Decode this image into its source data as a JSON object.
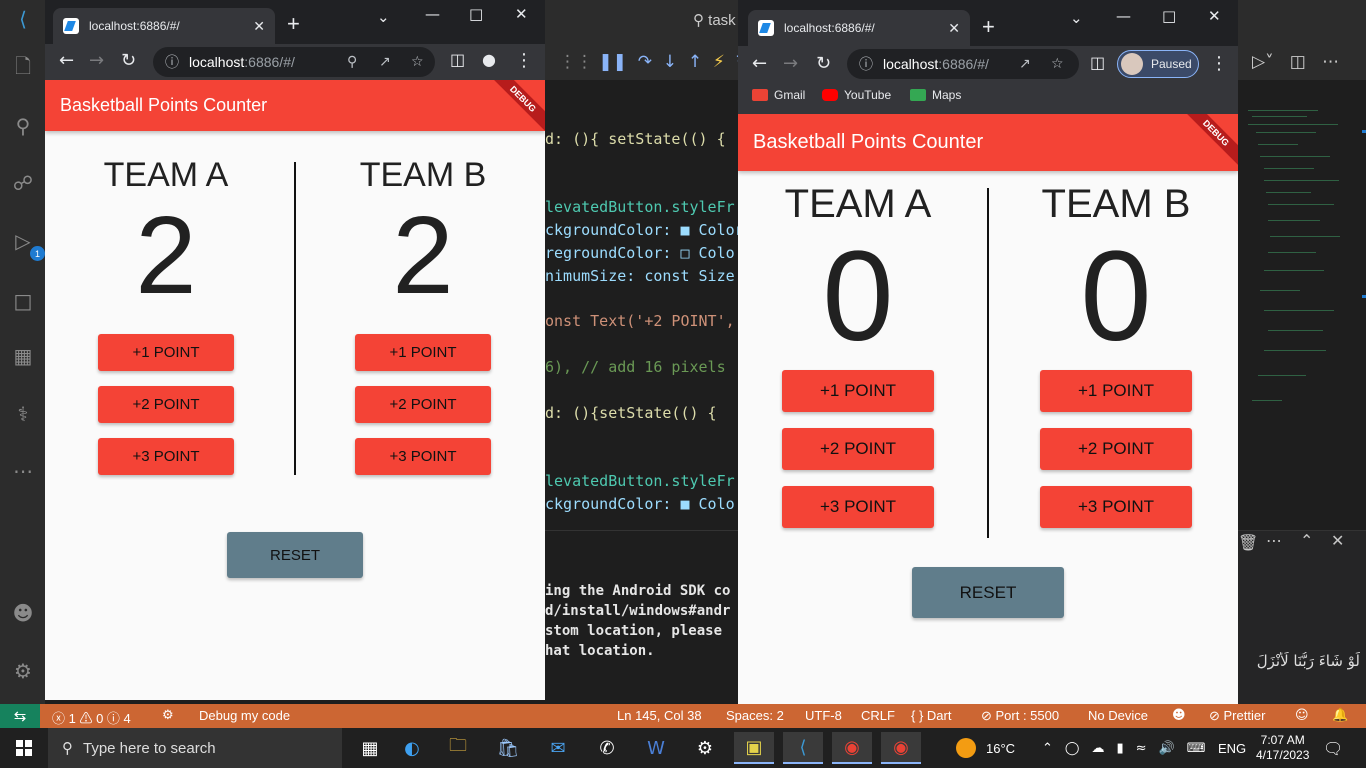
{
  "vscode": {
    "activity_badge": "1",
    "code_lines": [
      {
        "text": "d: (){ setState(() {",
        "cls": "fn"
      },
      {
        "text": "levatedButton.styleFr",
        "cls": "type"
      },
      {
        "text": "ckgroundColor: ■ Color",
        "cls": "prop"
      },
      {
        "text": "regroundColor: □ Colo",
        "cls": "prop"
      },
      {
        "text": "nimumSize: const Size",
        "cls": "prop"
      },
      {
        "text": "onst Text('+2 POINT',",
        "cls": "str"
      },
      {
        "text": "6), // add 16 pixels",
        "cls": "cmt"
      },
      {
        "text": "d: (){setState(() {",
        "cls": "fn"
      },
      {
        "text": "levatedButton.styleFr",
        "cls": "type"
      },
      {
        "text": "ckgroundColor: ■ Colo",
        "cls": "prop"
      }
    ],
    "terminal_lines": [
      "ing the Android SDK co",
      "d/install/windows#andr",
      "stom location, please",
      "hat location."
    ],
    "topbar_search": "task",
    "right_panel_text": "لَوْ شَاءَ رَبُّنَا لَأَنْزَلَ",
    "statusbar": {
      "problems": "ⓧ 1 ⚠ 0 ⓘ 4",
      "debug": "Debug my code",
      "position": "Ln 145, Col 38",
      "spaces": "Spaces: 2",
      "encoding": "UTF-8",
      "eol": "CRLF",
      "language": "{ } Dart",
      "port": "⊘ Port : 5500",
      "device": "No Device",
      "prettier": "⊘ Prettier"
    }
  },
  "taskbar": {
    "search_placeholder": "Type here to search",
    "weather": "16°C",
    "language": "ENG",
    "time": "7:07 AM",
    "date": "4/17/2023"
  },
  "browser_left": {
    "tab_title": "localhost:6886/#/",
    "url_host": "localhost",
    "url_path": ":6886/#/"
  },
  "browser_right": {
    "tab_title": "localhost:6886/#/",
    "url_host": "localhost",
    "url_path": ":6886/#/",
    "profile_label": "Paused",
    "bookmarks": [
      "Gmail",
      "YouTube",
      "Maps"
    ]
  },
  "app_left": {
    "title": "Basketball Points Counter",
    "debug": "DEBUG",
    "team_a": {
      "name": "TEAM A",
      "score": "2"
    },
    "team_b": {
      "name": "TEAM B",
      "score": "2"
    },
    "buttons": [
      "+1 POINT",
      "+2 POINT",
      "+3 POINT"
    ],
    "reset": "RESET"
  },
  "app_right": {
    "title": "Basketball Points Counter",
    "debug": "DEBUG",
    "team_a": {
      "name": "TEAM A",
      "score": "0"
    },
    "team_b": {
      "name": "TEAM B",
      "score": "0"
    },
    "buttons": [
      "+1 POINT",
      "+2 POINT",
      "+3 POINT"
    ],
    "reset": "RESET"
  },
  "colors": {
    "appbar": "#f44336",
    "button": "#f44336",
    "reset": "#607d8b",
    "statusbar": "#cc6633"
  }
}
